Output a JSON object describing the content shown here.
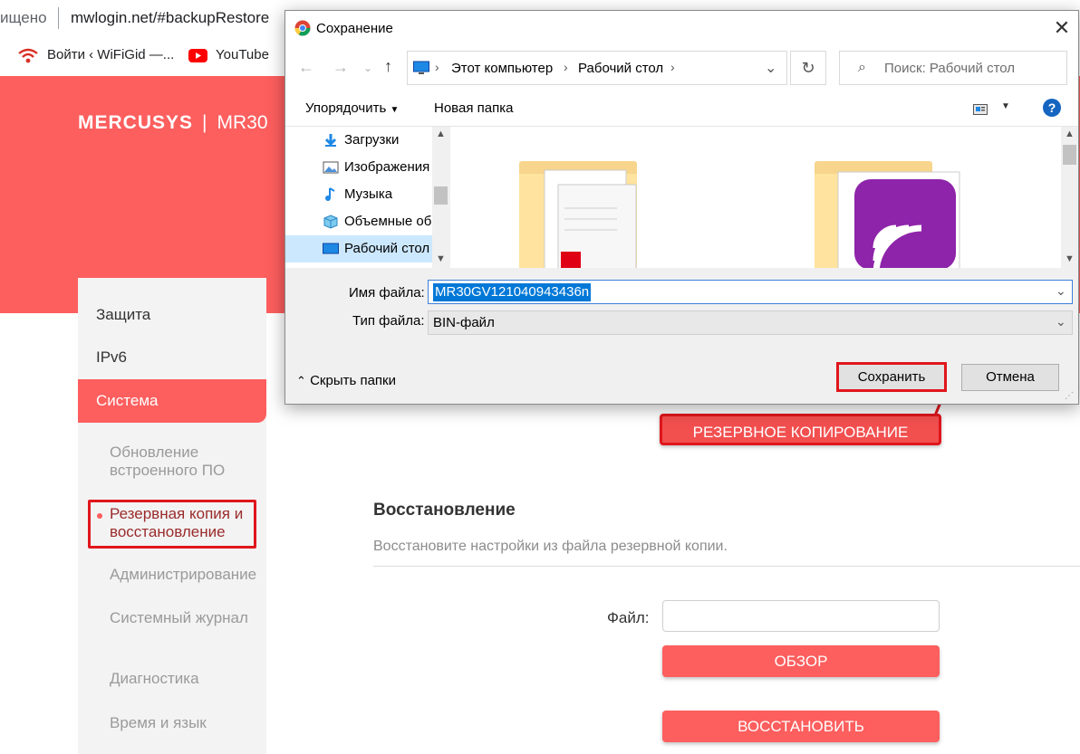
{
  "browser": {
    "security_text": "ищено",
    "url": "mwlogin.net/#backupRestore",
    "bookmarks": [
      {
        "label": "Войти ‹ WiFiGid —..."
      },
      {
        "label": "YouTube"
      }
    ]
  },
  "router": {
    "brand": "MERCUSYS",
    "model": "MR30",
    "sidebar": {
      "items": [
        "Защита",
        "IPv6"
      ],
      "active": "Система",
      "sub_items": [
        "Обновление встроенного ПО",
        "Резервная копия и восстановление",
        "Администрирование",
        "Системный журнал",
        "Диагностика",
        "Время и язык"
      ]
    },
    "backup_button": "РЕЗЕРВНОЕ КОПИРОВАНИЕ",
    "restore": {
      "title": "Восстановление",
      "description": "Восстановите настройки из файла резервной копии.",
      "file_label": "Файл:",
      "browse_button": "ОБЗОР",
      "restore_button": "ВОССТАНОВИТЬ"
    }
  },
  "dialog": {
    "title": "Сохранение",
    "path": [
      "Этот компьютер",
      "Рабочий стол"
    ],
    "search_placeholder": "Поиск: Рабочий стол",
    "toolbar": {
      "organize": "Упорядочить",
      "new_folder": "Новая папка"
    },
    "tree": [
      "Загрузки",
      "Изображения",
      "Музыка",
      "Объемные об",
      "Рабочий стол"
    ],
    "filename_label": "Имя файла:",
    "filename_value": "MR30GV121040943436n",
    "filetype_label": "Тип файла:",
    "filetype_value": "BIN-файл",
    "hide_folders": "Скрыть папки",
    "save_button": "Сохранить",
    "cancel_button": "Отмена"
  },
  "colors": {
    "brand_red": "#fd5e5e",
    "highlight_red": "#e0161c",
    "selection_blue": "#0078d7"
  }
}
